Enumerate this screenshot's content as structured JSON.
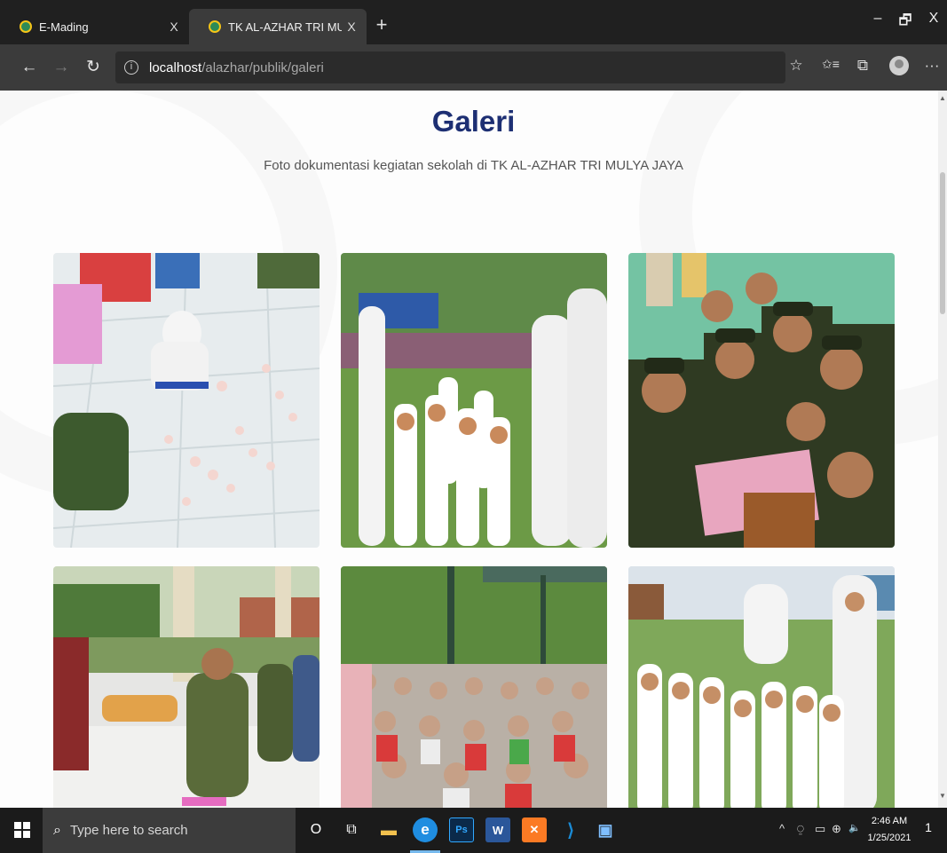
{
  "browser": {
    "tabs": [
      {
        "title": "E-Mading",
        "close": "X"
      },
      {
        "title": "TK AL-AZHAR TRI MULYA JAYA",
        "close": "X"
      }
    ],
    "new_tab": "+",
    "window_controls": {
      "minimize": "–",
      "restore": "🗗",
      "close": "X"
    },
    "nav": {
      "back": "←",
      "forward": "→",
      "refresh": "↻"
    },
    "address": {
      "info_glyph": "i",
      "host": "localhost",
      "path": "/alazhar/publik/galeri"
    },
    "toolbar": {
      "favorite": "☆",
      "favorites_list": "✩≡",
      "collections": "⧉",
      "more": "···"
    }
  },
  "page": {
    "title": "Galeri",
    "subtitle": "Foto dokumentasi kegiatan sekolah di TK AL-AZHAR TRI MULYA JAYA"
  },
  "taskbar": {
    "search_placeholder": "Type here to search",
    "cortana": "O",
    "task_view": "⧉",
    "apps": [
      {
        "name": "File Explorer",
        "glyph": "▬",
        "color": "#f2c14e"
      },
      {
        "name": "Microsoft Edge",
        "glyph": "e",
        "color": "#1f8de0"
      },
      {
        "name": "Photoshop",
        "glyph": "Ps",
        "color": "#0b2a4a"
      },
      {
        "name": "Word",
        "glyph": "W",
        "color": "#2b579a"
      },
      {
        "name": "XAMPP",
        "glyph": "✕",
        "color": "#fb7a24"
      },
      {
        "name": "Visual Studio Code",
        "glyph": "⟩",
        "color": "#1a8ad4"
      },
      {
        "name": "Photos",
        "glyph": "▣",
        "color": "#3a7fc4"
      }
    ],
    "tray": {
      "chevron": "^",
      "meet": "⍜",
      "battery": "▭",
      "network": "⊕",
      "volume": "🔈"
    },
    "time": "2:46 AM",
    "date": "1/25/2021",
    "notification_count": "1"
  }
}
